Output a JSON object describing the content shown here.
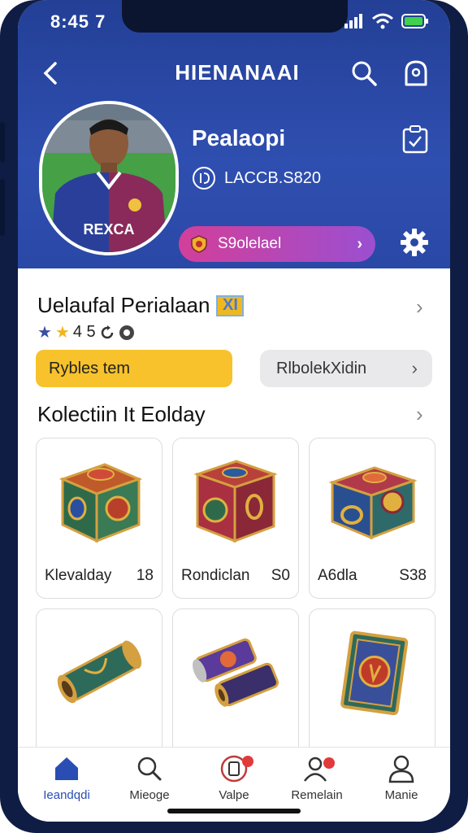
{
  "status": {
    "time": "8:45 7"
  },
  "nav": {
    "title": "HIENANAAI"
  },
  "profile": {
    "name": "Pealaopi",
    "id_text": "LACCB.S820",
    "jersey_text": "REXCA",
    "action_label": "S9olelael"
  },
  "item": {
    "title": "Uelaufal Perialaan",
    "badge": "XI",
    "rating_text": "4 5",
    "primary_button": "Rybles tem",
    "secondary_button": "RlbolekXidin"
  },
  "collection": {
    "title": "Kolectiin It Eolday",
    "cards": [
      {
        "name": "Klevalday",
        "price": "18"
      },
      {
        "name": "Rondiclan",
        "price": "S0"
      },
      {
        "name": "A6dla",
        "price": "S38"
      },
      {
        "name": "",
        "price": ""
      },
      {
        "name": "",
        "price": ""
      },
      {
        "name": "",
        "price": ""
      }
    ]
  },
  "tabs": [
    {
      "label": "Ieandqdi",
      "icon": "home-icon"
    },
    {
      "label": "Mieoge",
      "icon": "search-icon"
    },
    {
      "label": "Valpe",
      "icon": "card-icon"
    },
    {
      "label": "Remelain",
      "icon": "profile-alert-icon"
    },
    {
      "label": "Manie",
      "icon": "person-icon"
    }
  ],
  "colors": {
    "header_blue": "#2f4fb0",
    "accent_yellow": "#f7c22b",
    "pill_magenta": "#d23f9a",
    "active_tab": "#2a4db4"
  }
}
